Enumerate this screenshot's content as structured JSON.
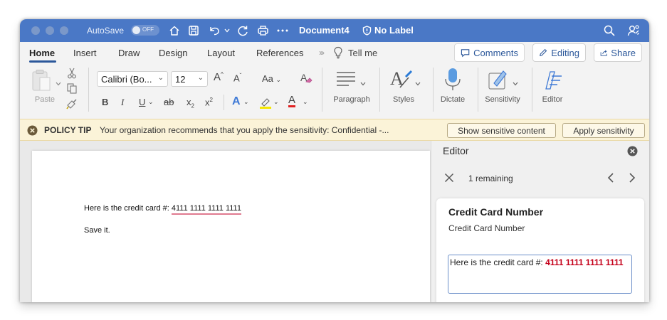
{
  "titlebar": {
    "autosave_label": "AutoSave",
    "autosave_state": "OFF",
    "document_title": "Document4",
    "sensitivity_label": "No Label",
    "color": "#4a78c6"
  },
  "menu": {
    "tabs": [
      "Home",
      "Insert",
      "Draw",
      "Design",
      "Layout",
      "References"
    ],
    "active_tab": "Home",
    "tell_me": "Tell me",
    "comments": "Comments",
    "editing": "Editing",
    "share": "Share"
  },
  "ribbon": {
    "paste": "Paste",
    "font_name": "Calibri (Bo...",
    "font_size": "12",
    "change_case": "Aa",
    "bold": "B",
    "italic": "I",
    "underline": "U",
    "strikethrough": "ab",
    "subscript": "x",
    "superscript": "x",
    "text_effects": "A",
    "font_color": "A",
    "grow_font": "A",
    "shrink_font": "A",
    "paragraph": "Paragraph",
    "styles": "Styles",
    "dictate": "Dictate",
    "sensitivity": "Sensitivity",
    "editor": "Editor",
    "accent_color": "#2b579a"
  },
  "policy": {
    "title": "POLICY TIP",
    "message": "Your organization recommends that you apply the sensitivity: Confidential -...",
    "show_button": "Show sensitive content",
    "apply_button": "Apply sensitivity"
  },
  "document": {
    "line1_prefix": "Here is the credit card #: ",
    "credit_card": "4111 1111 1111 1111",
    "line2": "Save it."
  },
  "editor_pane": {
    "title": "Editor",
    "remaining": "1 remaining",
    "card_title": "Credit Card Number",
    "card_subtitle": "Credit Card Number",
    "preview_prefix": "Here is the credit card #: ",
    "preview_highlight": "4111 1111 1111 1111",
    "highlight_color": "#c4001a"
  }
}
